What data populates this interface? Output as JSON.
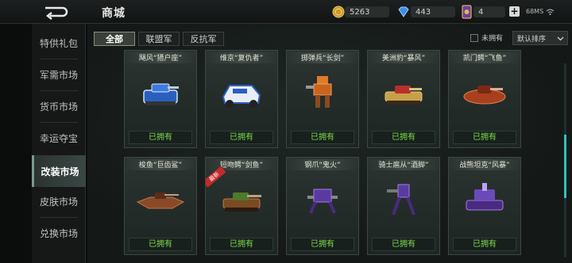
{
  "header": {
    "title": "商城",
    "gold": "5263",
    "diamonds": "443",
    "tickets": "4",
    "network": "68MS"
  },
  "sidebar": {
    "items": [
      {
        "label": "特供礼包",
        "active": false
      },
      {
        "label": "军需市场",
        "active": false
      },
      {
        "label": "货币市场",
        "active": false
      },
      {
        "label": "幸运夺宝",
        "active": false
      },
      {
        "label": "改装市场",
        "active": true
      },
      {
        "label": "皮肤市场",
        "active": false
      },
      {
        "label": "兑换市场",
        "active": false
      }
    ]
  },
  "filters": {
    "tabs": [
      "全部",
      "联盟军",
      "反抗军"
    ],
    "unowned_label": "未拥有",
    "sort_label": "默认排序"
  },
  "cards": [
    {
      "name": "飓风“猎户座”",
      "status": "已拥有",
      "icon": "blue-tank-icon"
    },
    {
      "name": "维京“复仇者”",
      "status": "已拥有",
      "icon": "blue-buggy-icon"
    },
    {
      "name": "掷弹兵“长剑”",
      "status": "已拥有",
      "icon": "orange-mech-icon"
    },
    {
      "name": "美洲豹“暴风”",
      "status": "已拥有",
      "icon": "desert-tank-icon"
    },
    {
      "name": "凯门鳄“飞鱼”",
      "status": "已拥有",
      "icon": "hovercraft-icon"
    },
    {
      "name": "梭鱼“巨齿鲨”",
      "status": "已拥有",
      "icon": "brown-hover-icon"
    },
    {
      "name": "短吻鳄“剑鱼”",
      "status": "已拥有",
      "icon": "brown-tank-icon",
      "ribbon": "最新"
    },
    {
      "name": "钢爪“鬼火”",
      "status": "已拥有",
      "icon": "purple-mech-icon"
    },
    {
      "name": "骑士扈从“酒脚”",
      "status": "已拥有",
      "icon": "purple-walker-icon"
    },
    {
      "name": "战熊坦克“风暴”",
      "status": "已拥有",
      "icon": "purple-tank-icon"
    }
  ],
  "colors": {
    "owned_text": "#7fdd4d",
    "accent": "#2ec4b6",
    "ribbon": "#c42a2a"
  }
}
